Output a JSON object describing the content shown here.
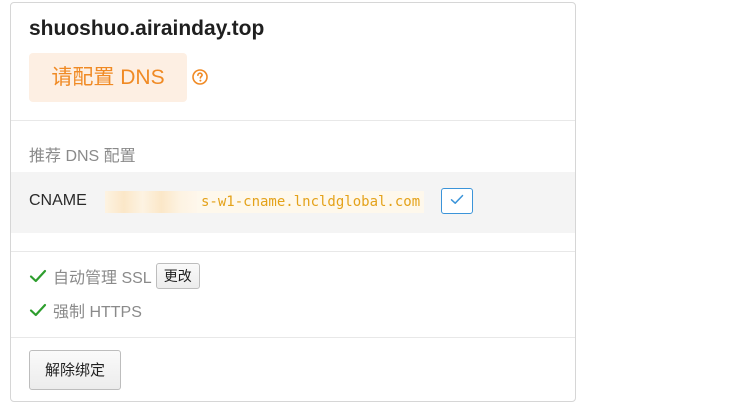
{
  "domain": {
    "title": "shuoshuo.airainday.top",
    "status_label": "请配置 DNS",
    "status_color": "#f08a24",
    "help_icon": "question-circle-icon"
  },
  "dns": {
    "section_label": "推荐 DNS 配置",
    "record_type": "CNAME",
    "record_value": "s-w1-cname.lncldglobal.com",
    "value_redacted": true,
    "copy_icon": "check-icon"
  },
  "features": [
    {
      "label": "自动管理 SSL",
      "enabled": true,
      "action_label": "更改"
    },
    {
      "label": "强制 HTTPS",
      "enabled": true
    }
  ],
  "actions": {
    "unbind_label": "解除绑定"
  },
  "colors": {
    "accent_blue": "#3b94d9",
    "success_green": "#2e9e2e",
    "badge_bg": "#fdefe3"
  }
}
